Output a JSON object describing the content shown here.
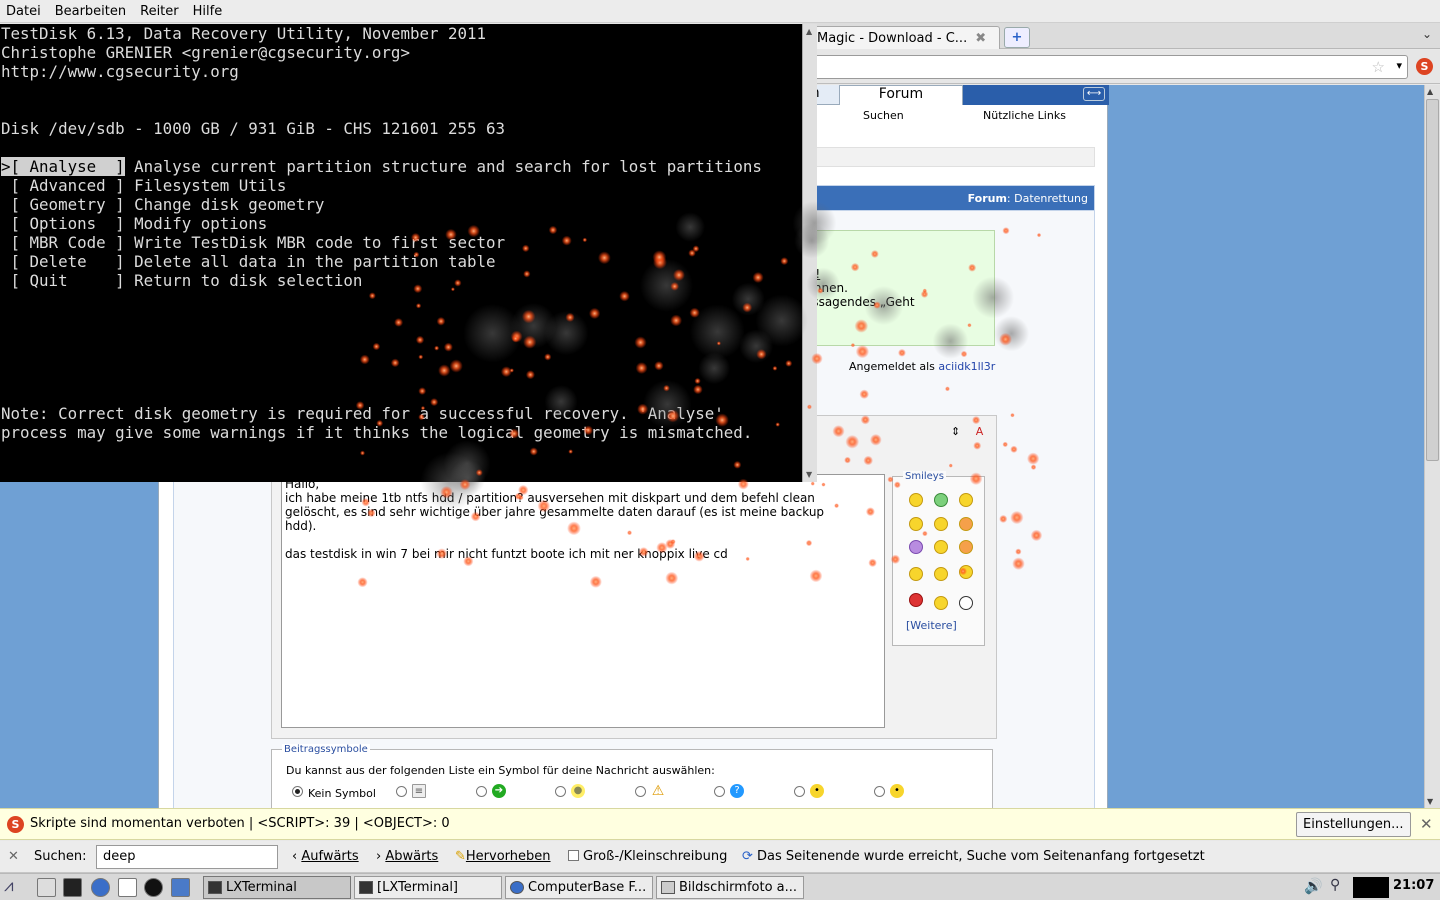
{
  "menubar": {
    "items": [
      "Datei",
      "Bearbeiten",
      "Reiter",
      "Hilfe"
    ]
  },
  "tabs": {
    "active_label": "Magic - Download - C...",
    "close_glyph": "✖",
    "new_tab_glyph": "+",
    "list_glyph": "⌄"
  },
  "terminal": {
    "lines": [
      "TestDisk 6.13, Data Recovery Utility, November 2011",
      "Christophe GRENIER <grenier@cgsecurity.org>",
      "http://www.cgsecurity.org",
      "",
      "",
      "Disk /dev/sdb - 1000 GB / 931 GiB - CHS 121601 255 63",
      ""
    ],
    "selected_marker": ">",
    "menu": [
      {
        "key": "[ Analyse  ]",
        "desc": "Analyse current partition structure and search for lost partitions"
      },
      {
        "key": "[ Advanced ]",
        "desc": "Filesystem Utils"
      },
      {
        "key": "[ Geometry ]",
        "desc": "Change disk geometry"
      },
      {
        "key": "[ Options  ]",
        "desc": "Modify options"
      },
      {
        "key": "[ MBR Code ]",
        "desc": "Write TestDisk MBR code to first sector"
      },
      {
        "key": "[ Delete   ]",
        "desc": "Delete all data in the partition table"
      },
      {
        "key": "[ Quit     ]",
        "desc": "Return to disk selection"
      }
    ],
    "note_line1": "Note: Correct disk geometry is required for a successful recovery. 'Analyse'",
    "note_line2": "process may give some warnings if it thinks the logical geometry is mismatched."
  },
  "forum": {
    "tab_partial": "ch",
    "tab_forum": "Forum",
    "sub_search": "Suchen",
    "sub_links": "Nützliche Links",
    "header_label": "Forum",
    "header_sep": ": ",
    "header_section": "Datenrettung",
    "green_line1": "tel!",
    "green_line2": "können.",
    "green_line3": "ntssagendes „Geht",
    "logged_in_label": "Angemeldet als",
    "logged_in_user": "aciidk1ll3r",
    "message_text": "Hallo,\nich habe meine 1tb ntfs hdd / partition? ausversehen mit diskpart und dem befehl clean\ngelöscht, es sind sehr wichtige über jahre gesammelte daten darauf (es ist meine backup\nhdd).\n\ndas testdisk in win 7 bei mir nicht funtzt boote ich mit ner knoppix live cd",
    "smileys_legend": "Smileys",
    "smileys_more": "[Weitere]",
    "beitrag_legend": "Beitragssymbole",
    "beitrag_desc": "Du kannst aus der folgenden Liste ein Symbol für deine Nachricht auswählen:",
    "kein_symbol": "Kein Symbol"
  },
  "noscript": {
    "message": "Skripte sind momentan verboten | <SCRIPT>: 39 | <OBJECT>: 0",
    "settings_button": "Einstellungen...",
    "close_glyph": "✕"
  },
  "findbar": {
    "close_glyph": "✕",
    "label": "Suchen:",
    "value": "deep",
    "prev_label": "Aufwärts",
    "next_label": "Abwärts",
    "highlight_label": "Hervorheben",
    "case_label": "Groß-/Kleinschreibung",
    "status": "Das Seitenende wurde erreicht, Suche vom Seitenanfang fortgesetzt"
  },
  "taskbar": {
    "tasks": [
      "LXTerminal",
      "[LXTerminal]",
      "ComputerBase F...",
      "Bildschirmfoto a..."
    ],
    "clock": "21:07"
  },
  "colors": {
    "ember": "#ff5a1e",
    "page_bg": "#6fa0d4",
    "forum_blue": "#3a6fb8"
  }
}
